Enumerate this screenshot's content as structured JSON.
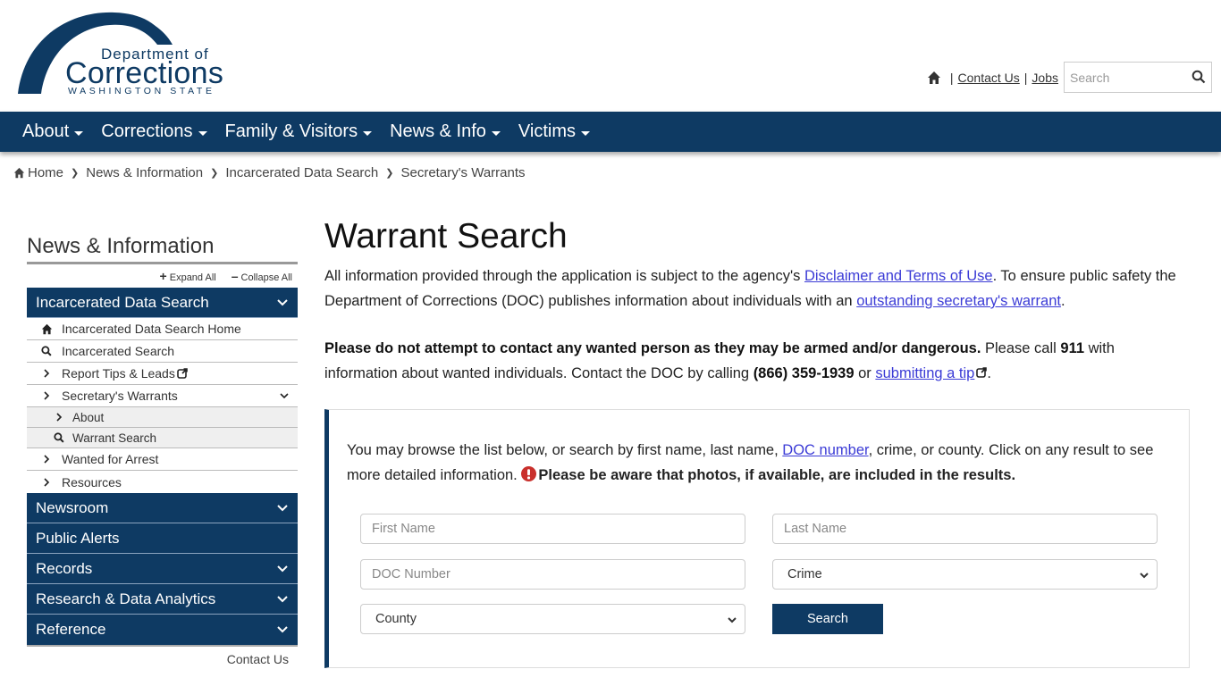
{
  "logo": {
    "line1": "Department of",
    "line2": "Corrections",
    "line3": "WASHINGTON STATE"
  },
  "utility": {
    "home_icon": "home-icon",
    "separator": "|",
    "links": [
      "Contact Us",
      "Jobs"
    ],
    "search_placeholder": "Search",
    "search_icon": "search-icon"
  },
  "nav": {
    "items": [
      "About",
      "Corrections",
      "Family & Visitors",
      "News & Info",
      "Victims"
    ]
  },
  "breadcrumb": {
    "items": [
      "Home",
      "News & Information",
      "Incarcerated Data Search",
      "Secretary's Warrants"
    ]
  },
  "sidebar": {
    "title": "News & Information",
    "expand_all": "Expand All",
    "collapse_all": "Collapse All",
    "active_section": "Incarcerated Data Search",
    "sub_items": [
      {
        "label": "Incarcerated Data Search Home",
        "icon": "home-icon"
      },
      {
        "label": "Incarcerated Search",
        "icon": "search-icon"
      },
      {
        "label": "Report Tips & Leads",
        "icon": "chevron-right-icon",
        "external": true
      },
      {
        "label": "Secretary's Warrants",
        "icon": "chevron-right-icon",
        "expanded": true
      },
      {
        "label": "About",
        "icon": "chevron-right-icon",
        "level": 2
      },
      {
        "label": "Warrant Search",
        "icon": "search-icon",
        "level": 2
      },
      {
        "label": "Wanted for Arrest",
        "icon": "chevron-right-icon"
      },
      {
        "label": "Resources",
        "icon": "chevron-right-icon"
      }
    ],
    "sections": [
      {
        "label": "Newsroom",
        "has_children": true
      },
      {
        "label": "Public Alerts",
        "has_children": false
      },
      {
        "label": "Records",
        "has_children": true
      },
      {
        "label": "Research & Data Analytics",
        "has_children": true
      },
      {
        "label": "Reference",
        "has_children": true
      }
    ],
    "footer_link": "Contact Us"
  },
  "main": {
    "title": "Warrant Search",
    "intro": {
      "t1": "All information provided through the application is subject to the agency's ",
      "link1": "Disclaimer and Terms of Use",
      "t2": ". To ensure public safety the Department of Corrections (DOC) publishes information about individuals with an ",
      "link2": "outstanding secretary's warrant",
      "t3": "."
    },
    "warning": {
      "bold1": "Please do not attempt to contact any wanted person as they may be armed and/or dangerous.",
      "t1": " Please call ",
      "bold2": "911",
      "t2": " with information about wanted individuals. Contact the DOC by calling ",
      "phone": "(866) 359-1939",
      "t3": " or ",
      "link": "submitting a tip",
      "t4": "."
    },
    "search_box": {
      "t1": "You may browse the list below, or search by first name, last name, ",
      "link": "DOC number",
      "t2": ", crime, or county. Click on any result to see more detailed information. ",
      "bold": "Please be aware that photos, if available, are included in the results.",
      "first_name_placeholder": "First Name",
      "last_name_placeholder": "Last Name",
      "doc_number_placeholder": "DOC Number",
      "crime_selected": "Crime",
      "county_selected": "County",
      "search_button": "Search"
    }
  },
  "colors": {
    "brand_navy": "#0e3a63",
    "link": "#3b3bd6",
    "warning_red": "#c9302c"
  }
}
